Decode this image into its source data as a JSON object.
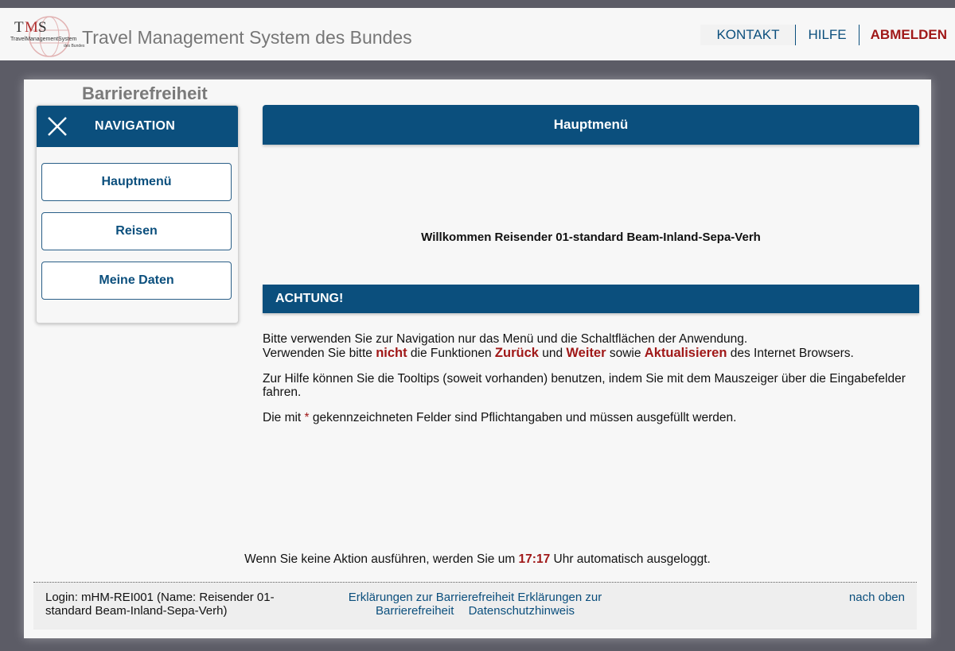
{
  "header": {
    "logo_text": "TMS TravelManagementSystem des Bundes",
    "app_title": "Travel Management System des Bundes",
    "nav": {
      "contact": "KONTAKT",
      "help": "HILFE",
      "logout": "ABMELDEN"
    }
  },
  "accessibility_title": "Barrierefreiheit",
  "navigation": {
    "title": "NAVIGATION",
    "items": [
      {
        "label": "Hauptmenü"
      },
      {
        "label": "Reisen"
      },
      {
        "label": "Meine Daten"
      }
    ]
  },
  "content": {
    "title": "Hauptmenü",
    "welcome": "Willkommen Reisender 01-standard Beam-Inland-Sepa-Verh",
    "warning": {
      "title": "ACHTUNG!",
      "line1": "Bitte verwenden Sie zur Navigation nur das Menü und die Schaltflächen der Anwendung.",
      "line2_a": "Verwenden Sie bitte ",
      "line2_nicht": "nicht",
      "line2_b": " die Funktionen ",
      "line2_zurueck": "Zurück",
      "line2_c": " und ",
      "line2_weiter": "Weiter",
      "line2_d": " sowie ",
      "line2_aktualisieren": "Aktualisieren",
      "line2_e": " des Internet Browsers.",
      "tooltip_hint": "Zur Hilfe können Sie die Tooltips (soweit vorhanden) benutzen, indem Sie mit dem Mauszeiger über die Eingabefelder fahren.",
      "required_a": "Die mit ",
      "required_star": "*",
      "required_b": " gekennzeichneten Felder sind Pflichtangaben und müssen ausgefüllt werden."
    }
  },
  "timeout": {
    "before": "Wenn Sie keine Aktion ausführen, werden Sie um ",
    "time": "17:17",
    "after": " Uhr automatisch ausgeloggt."
  },
  "footer": {
    "login_info": "Login: mHM-REI001 (Name: Reisender 01-standard Beam-Inland-Sepa-Verh)",
    "accessibility_link": "Erklärungen zur Barrierefreiheit Erklärungen zur Barrierefreiheit",
    "privacy_link": "Datenschutzhinweis",
    "to_top": "nach oben"
  },
  "colors": {
    "primary": "#0b4f7d",
    "accent_red": "#a01818",
    "background": "#5c5c66"
  }
}
